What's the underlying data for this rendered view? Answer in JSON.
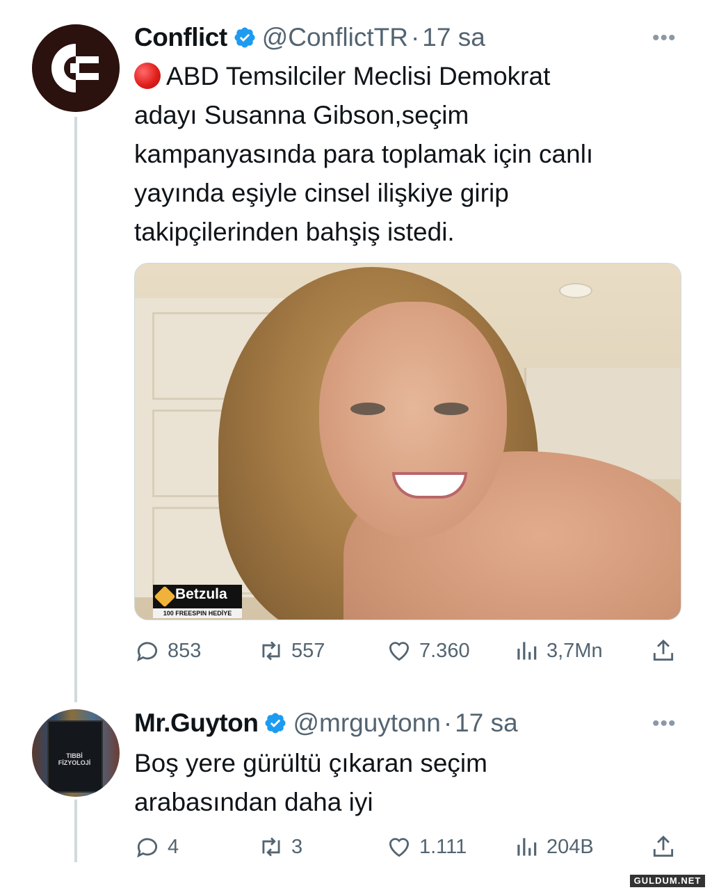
{
  "tweet1": {
    "name": "Conflict",
    "handle": "@ConflictTR",
    "separator": "·",
    "time": "17 sa",
    "text": "ABD Temsilciler Meclisi Demokrat\nadayı Susanna Gibson,seçim\nkampanyasında para toplamak için canlı\nyayında eşiyle cinsel ilişkiye girip\ntakipçilerinden bahşiş istedi.",
    "media": {
      "watermark_brand": "Betzula",
      "watermark_sub": "100 FREESPIN HEDİYE"
    },
    "stats": {
      "replies": "853",
      "retweets": "557",
      "likes": "7.360",
      "views": "3,7Mn"
    }
  },
  "tweet2": {
    "name": "Mr.Guyton",
    "handle": "@mrguytonn",
    "separator": "·",
    "time": "17 sa",
    "text": "Boş yere gürültü çıkaran seçim\narabasından daha iyi",
    "avatar_book_title": "TIBBİ\nFİZYOLOJİ",
    "stats": {
      "replies": "4",
      "retweets": "3",
      "likes": "1.111",
      "views": "204B"
    }
  },
  "more_icon": "•••",
  "credit": "GULDUM.NET",
  "colors": {
    "text": "#0f1419",
    "secondary": "#536471",
    "verified": "#1d9bf0",
    "thread_line": "#cfd9de"
  }
}
